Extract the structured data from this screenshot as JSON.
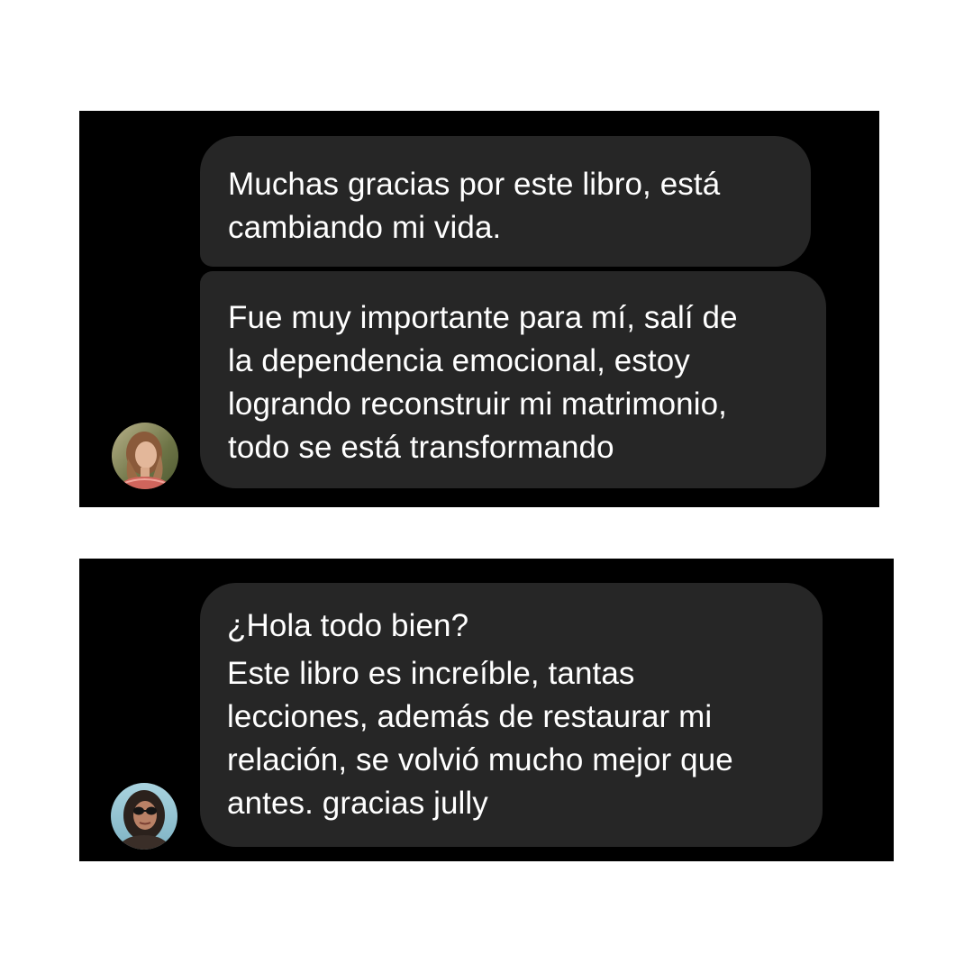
{
  "conversations": [
    {
      "messages": [
        {
          "text": "Muchas gracias por este libro, está\ncambiando mi vida."
        },
        {
          "text": "Fue muy importante para mí, salí de\nla dependencia emocional, estoy\nlogrando reconstruir mi matrimonio,\ntodo se está transformando"
        }
      ],
      "avatar_icon": "user-avatar-icon"
    },
    {
      "messages": [
        {
          "greeting": "¿Hola todo bien?",
          "text": "Este libro es increíble, tantas\nlecciones, además de restaurar mi\nrelación, se volvió mucho mejor que\nantes. gracias jully"
        }
      ],
      "avatar_icon": "user-avatar-icon"
    }
  ],
  "colors": {
    "page_background": "#ffffff",
    "panel_background": "#000000",
    "bubble_background": "#262626",
    "text": "#ffffff"
  }
}
